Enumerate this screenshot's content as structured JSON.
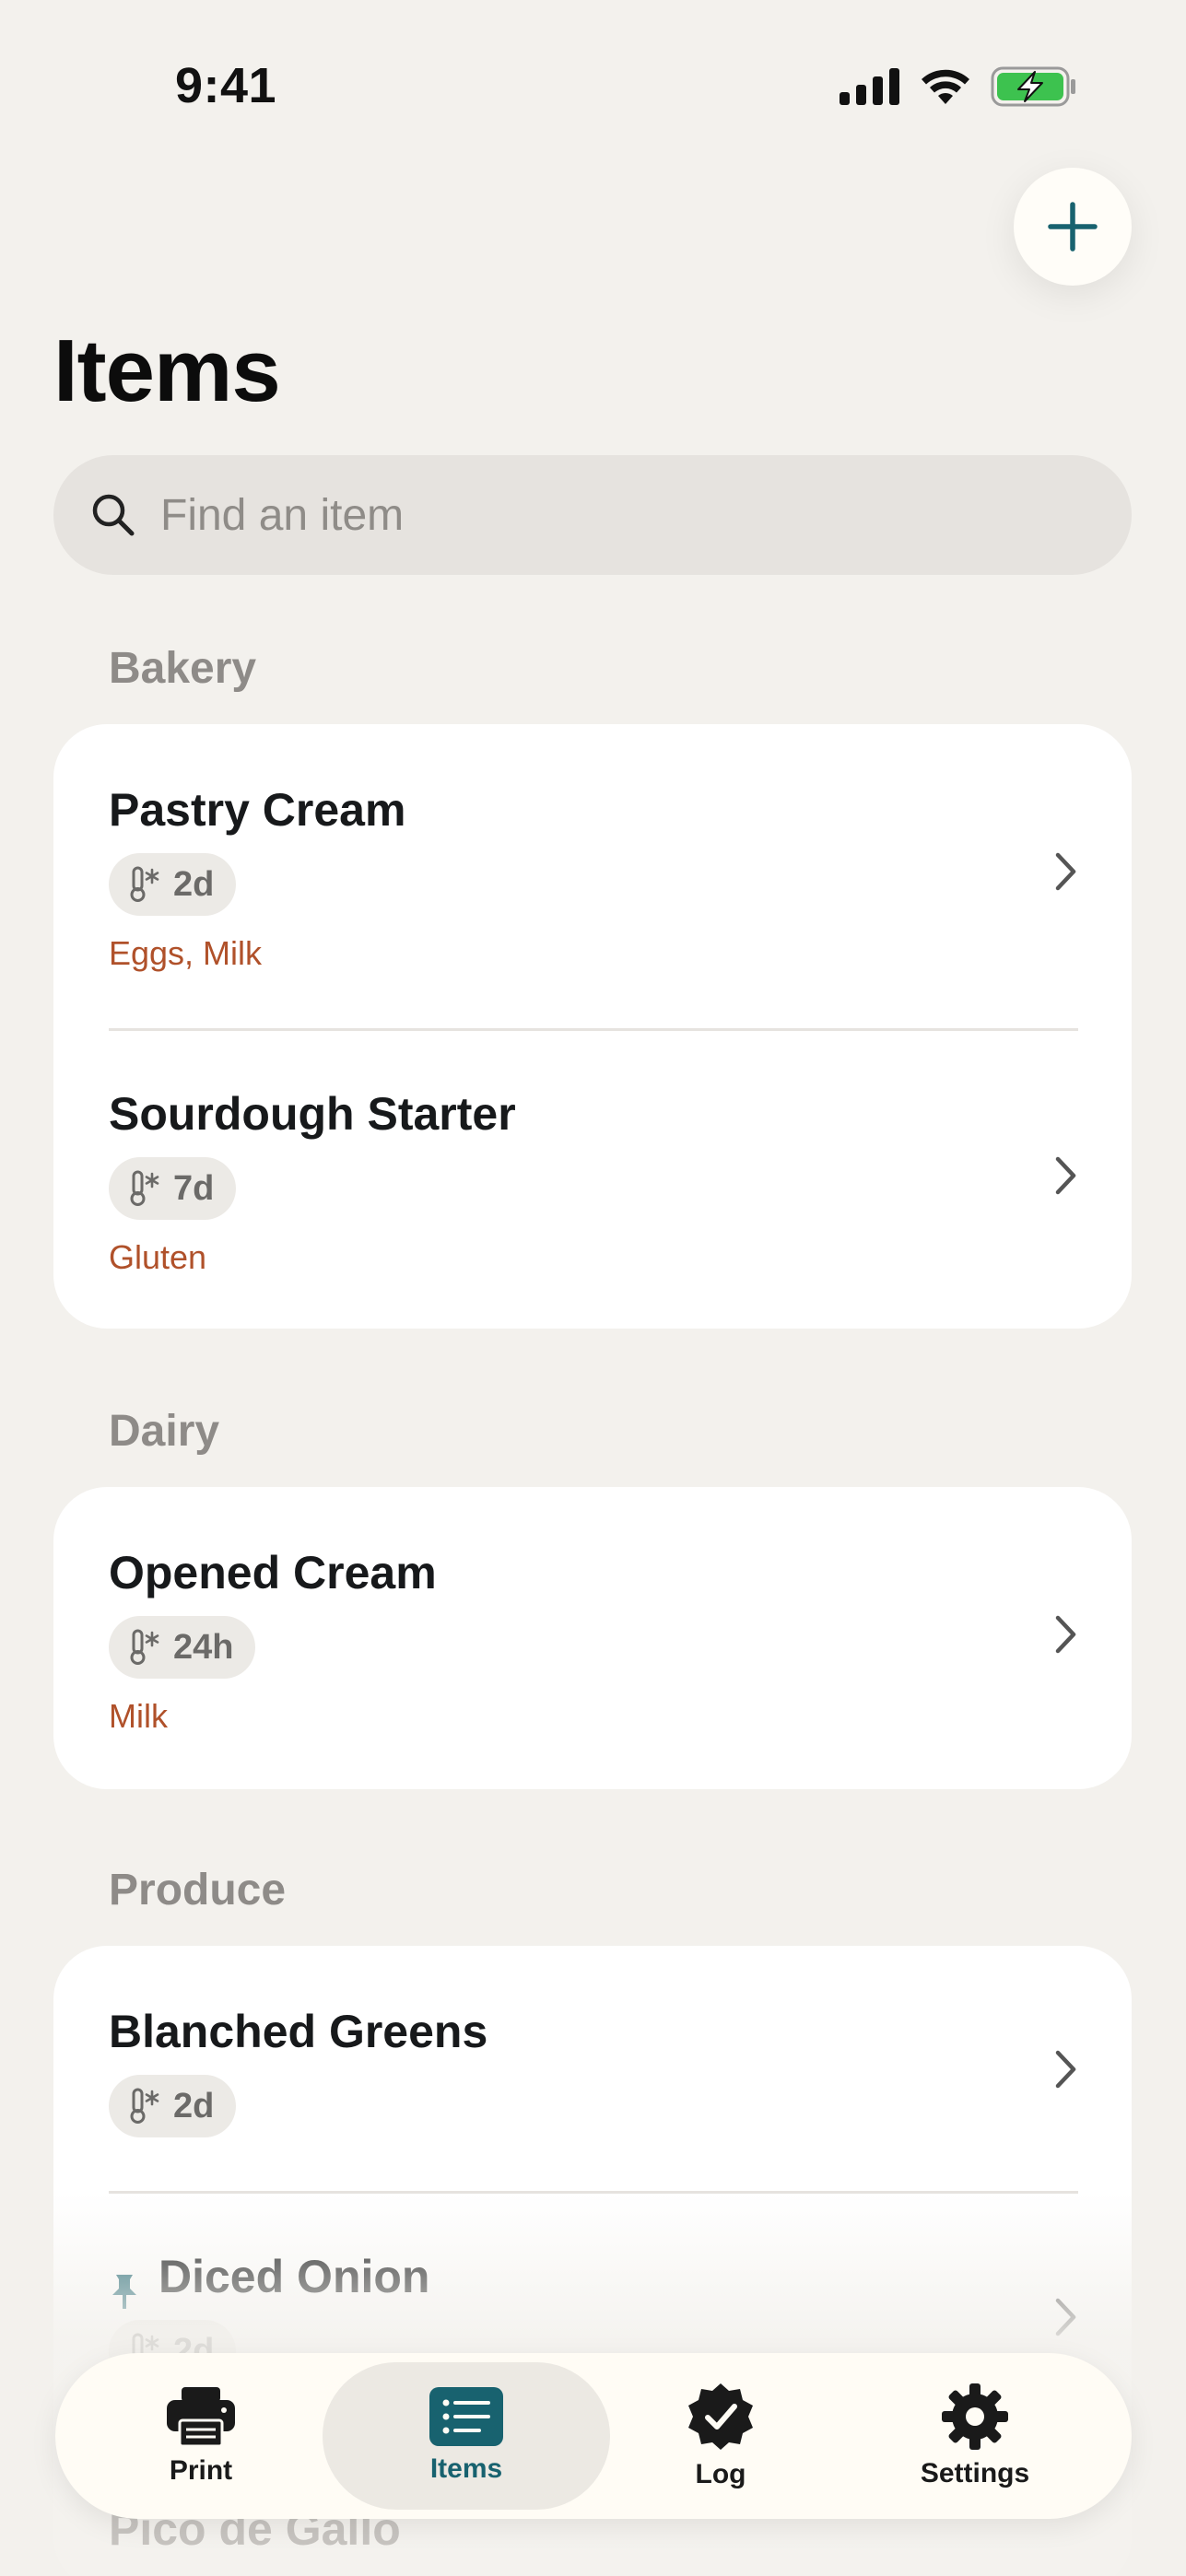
{
  "status_bar": {
    "time": "9:41"
  },
  "header": {
    "title": "Items"
  },
  "search": {
    "placeholder": "Find an item"
  },
  "colors": {
    "accent": "#18626F",
    "allergen": "#B0512A",
    "background": "#F3F1ED"
  },
  "sections": [
    {
      "title": "Bakery",
      "items": [
        {
          "name": "Pastry Cream",
          "shelf_life": "2d",
          "allergens": "Eggs, Milk"
        },
        {
          "name": "Sourdough Starter",
          "shelf_life": "7d",
          "allergens": "Gluten"
        }
      ]
    },
    {
      "title": "Dairy",
      "items": [
        {
          "name": "Opened Cream",
          "shelf_life": "24h",
          "allergens": "Milk"
        }
      ]
    },
    {
      "title": "Produce",
      "items": [
        {
          "name": "Blanched Greens",
          "shelf_life": "2d"
        },
        {
          "name": "Diced Onion",
          "shelf_life": "2d",
          "pinned": true
        },
        {
          "name": "Pico de Gallo"
        }
      ]
    }
  ],
  "tabs": [
    {
      "label": "Print",
      "icon": "printer-icon"
    },
    {
      "label": "Items",
      "icon": "list-icon",
      "active": true
    },
    {
      "label": "Log",
      "icon": "checkmark-badge-icon"
    },
    {
      "label": "Settings",
      "icon": "gear-icon"
    }
  ]
}
